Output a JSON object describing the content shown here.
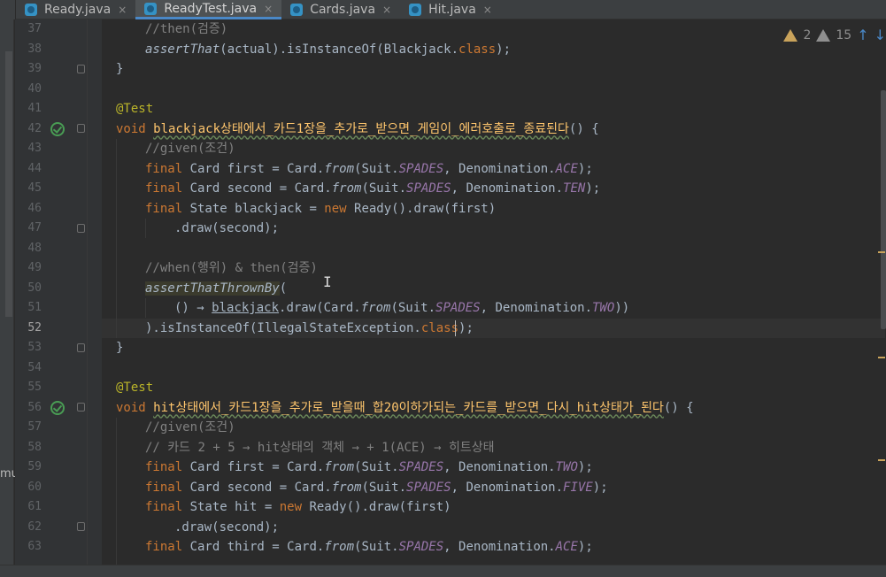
{
  "tabs": [
    {
      "label": "Ready.java",
      "icon": "java-class-icon",
      "active": false
    },
    {
      "label": "ReadyTest.java",
      "icon": "java-test-class-icon",
      "active": true
    },
    {
      "label": "Cards.java",
      "icon": "java-class-icon",
      "active": false
    },
    {
      "label": "Hit.java",
      "icon": "java-class-icon",
      "active": false
    }
  ],
  "close_glyph": "×",
  "inspection": {
    "warnings": "2",
    "weak_warnings": "15"
  },
  "left_strip_text": "mu",
  "lines": [
    {
      "n": "37"
    },
    {
      "n": "38"
    },
    {
      "n": "39"
    },
    {
      "n": "40"
    },
    {
      "n": "41"
    },
    {
      "n": "42"
    },
    {
      "n": "43"
    },
    {
      "n": "44"
    },
    {
      "n": "45"
    },
    {
      "n": "46"
    },
    {
      "n": "47"
    },
    {
      "n": "48"
    },
    {
      "n": "49"
    },
    {
      "n": "50"
    },
    {
      "n": "51"
    },
    {
      "n": "52"
    },
    {
      "n": "53"
    },
    {
      "n": "54"
    },
    {
      "n": "55"
    },
    {
      "n": "56"
    },
    {
      "n": "57"
    },
    {
      "n": "58"
    },
    {
      "n": "59"
    },
    {
      "n": "60"
    },
    {
      "n": "61"
    },
    {
      "n": "62"
    },
    {
      "n": "63"
    }
  ],
  "code": {
    "l37": "//then(검증)",
    "l38a": "assertThat",
    "l38b": "(actual).isInstanceOf(Blackjack.",
    "l38c": "class",
    "l38d": ");",
    "l39": "}",
    "l41": "@Test",
    "l42a": "void ",
    "l42b": "blackjack상태에서_카드1장을_추가로_받으면_게임이_에러호출로_종료된다",
    "l42c": "() {",
    "l43": "//given(조건)",
    "l44a": "final ",
    "l44b": "Card first = Card.",
    "l44c": "from",
    "l44d": "(Suit.",
    "l44e": "SPADES",
    "l44f": ", Denomination.",
    "l44g": "ACE",
    "l44h": ");",
    "l45a": "final ",
    "l45b": "Card second = Card.",
    "l45c": "from",
    "l45d": "(Suit.",
    "l45e": "SPADES",
    "l45f": ", Denomination.",
    "l45g": "TEN",
    "l45h": ");",
    "l46a": "final ",
    "l46b": "State blackjack = ",
    "l46c": "new ",
    "l46d": "Ready().draw(first)",
    "l47": ".draw(second);",
    "l49": "//when(행위) & then(검증)",
    "l50a": "assertThatThrownBy",
    "l50b": "(",
    "l51a": "() → ",
    "l51b": "blackjack",
    "l51c": ".draw(Card.",
    "l51d": "from",
    "l51e": "(Suit.",
    "l51f": "SPADES",
    "l51g": ", Denomination.",
    "l51h": "TWO",
    "l51i": "))",
    "l52a": ").isInstanceOf(IllegalStateException.",
    "l52b": "class",
    "l52c": ");",
    "l53": "}",
    "l55": "@Test",
    "l56a": "void ",
    "l56b": "hit상태에서_카드1장을_추가로_받을때_합20이하가되는_카드를_받으면_다시_hit상태가_된다",
    "l56c": "() {",
    "l57": "//given(조건)",
    "l58": "// 카드 2 + 5 → hit상태의 객체 → + 1(ACE) → 히트상태",
    "l59a": "final ",
    "l59b": "Card first = Card.",
    "l59c": "from",
    "l59d": "(Suit.",
    "l59e": "SPADES",
    "l59f": ", Denomination.",
    "l59g": "TWO",
    "l59h": ");",
    "l60a": "final ",
    "l60b": "Card second = Card.",
    "l60c": "from",
    "l60d": "(Suit.",
    "l60e": "SPADES",
    "l60f": ", Denomination.",
    "l60g": "FIVE",
    "l60h": ");",
    "l61a": "final ",
    "l61b": "State hit = ",
    "l61c": "new ",
    "l61d": "Ready().draw(first)",
    "l62": ".draw(second);",
    "l63a": "final ",
    "l63b": "Card third = Card.",
    "l63c": "from",
    "l63d": "(Suit.",
    "l63e": "SPADES",
    "l63f": ", Denomination.",
    "l63g": "ACE",
    "l63h": ");"
  },
  "colors": {
    "background": "#2b2b2b",
    "keyword": "#cc7832",
    "comment": "#808080",
    "annotation": "#bbb529",
    "static_field": "#9876aa",
    "default_text": "#a9b7c6",
    "test_pass": "#499c54"
  }
}
